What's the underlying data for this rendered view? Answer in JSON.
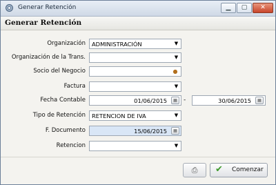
{
  "window": {
    "title": "Generar Retención"
  },
  "header": {
    "title": "Generar Retención"
  },
  "form": {
    "organizacion": {
      "label": "Organización",
      "value": "ADMINISTRACIÓN"
    },
    "organizacion_trans": {
      "label": "Organización de la Trans.",
      "value": ""
    },
    "socio": {
      "label": "Socio del Negocio",
      "value": ""
    },
    "factura": {
      "label": "Factura",
      "value": ""
    },
    "fecha_contable": {
      "label": "Fecha Contable",
      "from": "01/06/2015",
      "separator": "-",
      "to": "30/06/2015"
    },
    "tipo_retencion": {
      "label": "Tipo de Retención",
      "value": "RETENCION DE IVA"
    },
    "f_documento": {
      "label": "F. Documento",
      "value": "15/06/2015"
    },
    "retencion": {
      "label": "Retencion",
      "value": ""
    }
  },
  "buttons": {
    "comenzar": "Comenzar"
  },
  "icons": {
    "app": "gear-icon",
    "print": "print-icon",
    "ok": "check-icon",
    "calendar": "calendar-icon",
    "bpartner": "user-icon"
  },
  "colors": {
    "titlebar": "#cfd9e6",
    "close": "#c8452a",
    "selected_field": "#d9e6f6",
    "check": "#3e9a2c"
  }
}
